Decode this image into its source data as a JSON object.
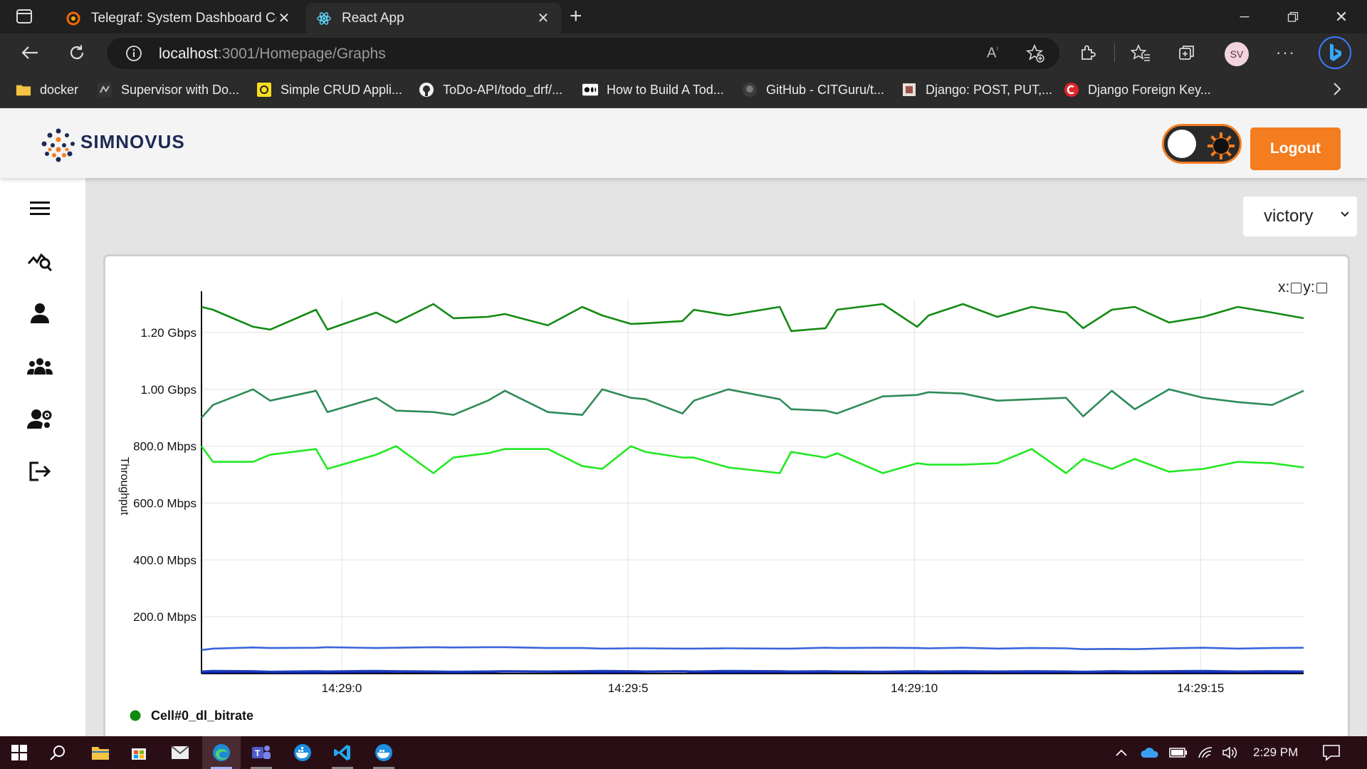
{
  "browser": {
    "tabs": [
      {
        "title": "Telegraf: System Dashboard Copy",
        "icon": "grafana-icon",
        "active": false
      },
      {
        "title": "React App",
        "icon": "react-icon",
        "active": true
      }
    ],
    "url_host": "localhost",
    "url_path": ":3001/Homepage/Graphs",
    "profile_initials": "SV",
    "bookmarks": [
      {
        "label": "docker",
        "icon": "folder-icon"
      },
      {
        "label": "Supervisor with Do...",
        "icon": "supervisor-icon"
      },
      {
        "label": "Simple CRUD Appli...",
        "icon": "crud-icon"
      },
      {
        "label": "ToDo-API/todo_drf/...",
        "icon": "github-icon"
      },
      {
        "label": "How to Build A Tod...",
        "icon": "medium-icon"
      },
      {
        "label": "GitHub - CITGuru/t...",
        "icon": "github-icon"
      },
      {
        "label": "Django: POST, PUT,...",
        "icon": "page-icon"
      },
      {
        "label": "Django Foreign Key...",
        "icon": "django-red-icon"
      }
    ]
  },
  "app": {
    "brand": "SIMNOVUS",
    "logout_label": "Logout",
    "library_select_value": "victory",
    "axis_toggle_x": "x:",
    "axis_toggle_y": "y:",
    "colors": {
      "accent": "#f47d20",
      "brand_text": "#1c2a55"
    }
  },
  "chart_data": {
    "type": "line",
    "ylabel": "Throughput",
    "xlabel": "",
    "x_ticks": [
      "14:29:0",
      "14:29:5",
      "14:29:10",
      "14:29:15"
    ],
    "x_tick_positions_s": [
      0,
      5,
      10,
      15
    ],
    "x_range_s": [
      -2.45,
      16.8
    ],
    "y_ticks": [
      "200.0 Mbps",
      "400.0 Mbps",
      "600.0 Mbps",
      "800.0 Mbps",
      "1.00 Gbps",
      "1.20 Gbps"
    ],
    "y_tick_values_mbps": [
      200,
      400,
      600,
      800,
      1000,
      1200
    ],
    "ylim_mbps": [
      0,
      1320
    ],
    "grid": true,
    "legend": [
      {
        "name": "Cell#0_dl_bitrate",
        "color": "#128a12"
      }
    ],
    "x_seconds": [
      -2.45,
      -2.25,
      -1.55,
      -1.25,
      -0.45,
      -0.25,
      0.6,
      0.95,
      1.6,
      1.95,
      2.55,
      2.85,
      3.6,
      4.2,
      4.55,
      5.05,
      5.3,
      5.95,
      6.15,
      6.75,
      7.65,
      7.85,
      8.45,
      8.65,
      9.45,
      10.05,
      10.25,
      10.85,
      11.45,
      12.05,
      12.65,
      12.95,
      13.45,
      13.85,
      14.45,
      15.05,
      15.65,
      16.25,
      16.8
    ],
    "series": [
      {
        "name": "Cell#0_dl_bitrate",
        "color": "#128a12",
        "values": [
          1290,
          1280,
          1220,
          1210,
          1280,
          1210,
          1270,
          1235,
          1300,
          1250,
          1255,
          1265,
          1225,
          1290,
          1260,
          1230,
          1232,
          1240,
          1280,
          1260,
          1290,
          1205,
          1215,
          1280,
          1300,
          1220,
          1260,
          1300,
          1255,
          1290,
          1270,
          1215,
          1280,
          1290,
          1235,
          1255,
          1290,
          1270,
          1250
        ]
      },
      {
        "name": "",
        "color": "#2e8b57",
        "values": [
          900,
          945,
          1000,
          960,
          995,
          920,
          970,
          925,
          920,
          910,
          960,
          995,
          920,
          910,
          1000,
          970,
          965,
          915,
          960,
          1000,
          965,
          930,
          925,
          915,
          975,
          980,
          990,
          985,
          960,
          965,
          970,
          905,
          995,
          930,
          1000,
          970,
          955,
          945,
          995
        ]
      },
      {
        "name": "",
        "color": "#22e822",
        "values": [
          800,
          745,
          745,
          770,
          790,
          720,
          770,
          800,
          705,
          760,
          775,
          790,
          790,
          730,
          720,
          800,
          780,
          760,
          760,
          725,
          705,
          780,
          760,
          775,
          705,
          740,
          735,
          735,
          740,
          790,
          705,
          755,
          720,
          755,
          710,
          720,
          745,
          740,
          725
        ]
      },
      {
        "name": "",
        "color": "#3a64db",
        "values": [
          83,
          88,
          92,
          90,
          91,
          93,
          90,
          91,
          93,
          92,
          93,
          93,
          90,
          90,
          88,
          89,
          89,
          88,
          88,
          89,
          88,
          88,
          91,
          90,
          91,
          90,
          89,
          91,
          88,
          90,
          89,
          86,
          87,
          86,
          89,
          91,
          88,
          90,
          91
        ]
      },
      {
        "name": "",
        "color": "#1f3fbf",
        "values": [
          8,
          10,
          9,
          7,
          9,
          8,
          10,
          9,
          8,
          7,
          8,
          9,
          8,
          9,
          10,
          9,
          8,
          9,
          8,
          10,
          9,
          8,
          9,
          8,
          7,
          9,
          8,
          9,
          8,
          9,
          8,
          7,
          9,
          8,
          9,
          10,
          8,
          9,
          8
        ]
      },
      {
        "name": "",
        "color": "#0b1fa8",
        "values": [
          3,
          4,
          5,
          4,
          3,
          4,
          5,
          6,
          5,
          4,
          5,
          7,
          6,
          5,
          4,
          5,
          6,
          7,
          5,
          4,
          5,
          4,
          5,
          6,
          5,
          4,
          5,
          4,
          5,
          4,
          5,
          4,
          5,
          4,
          5,
          4,
          5,
          4,
          5
        ]
      }
    ]
  },
  "taskbar": {
    "time": "2:29 PM",
    "apps": [
      "windows-start-icon",
      "search-icon",
      "file-explorer-icon",
      "store-icon",
      "mail-icon",
      "edge-icon",
      "teams-icon",
      "docker-icon",
      "vscode-icon",
      "docker-desktop-icon"
    ]
  }
}
